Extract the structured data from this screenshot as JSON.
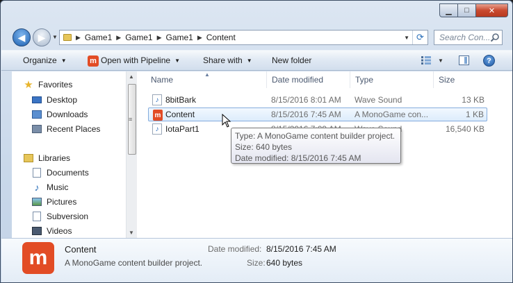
{
  "window": {
    "minimize": "▁",
    "maximize": "□",
    "close": "✕"
  },
  "address": {
    "crumbs": [
      "Game1",
      "Game1",
      "Game1",
      "Content"
    ]
  },
  "search": {
    "placeholder": "Search Con..."
  },
  "toolbar": {
    "organize": "Organize",
    "open_with": "Open with Pipeline",
    "share_with": "Share with",
    "new_folder": "New folder"
  },
  "navigation": {
    "favorites_header": "Favorites",
    "favorites": [
      "Desktop",
      "Downloads",
      "Recent Places"
    ],
    "libraries_header": "Libraries",
    "libraries": [
      "Documents",
      "Music",
      "Pictures",
      "Subversion",
      "Videos"
    ]
  },
  "columns": {
    "name": "Name",
    "date": "Date modified",
    "type": "Type",
    "size": "Size"
  },
  "files": [
    {
      "name": "8bitBark",
      "date": "8/15/2016 8:01 AM",
      "type": "Wave Sound",
      "size": "13 KB",
      "icon": "wave-sound-icon"
    },
    {
      "name": "Content",
      "date": "8/15/2016 7:45 AM",
      "type": "A MonoGame con...",
      "size": "1 KB",
      "icon": "monogame-icon"
    },
    {
      "name": "IotaPart1",
      "date": "8/15/2016 7:09 AM",
      "type": "Wave Sound",
      "size": "16,540 KB",
      "icon": "wave-sound-icon"
    }
  ],
  "tooltip": {
    "type": "Type: A MonoGame content builder project.",
    "size": "Size: 640 bytes",
    "date": "Date modified: 8/15/2016 7:45 AM"
  },
  "details": {
    "name": "Content",
    "type": "A MonoGame content builder project.",
    "date_label": "Date modified:",
    "date_value": "8/15/2016 7:45 AM",
    "size_label": "Size:",
    "size_value": "640 bytes"
  },
  "colors": {
    "accent": "#e24c25",
    "selection": "#dcecfc",
    "selection_border": "#84acdd"
  }
}
